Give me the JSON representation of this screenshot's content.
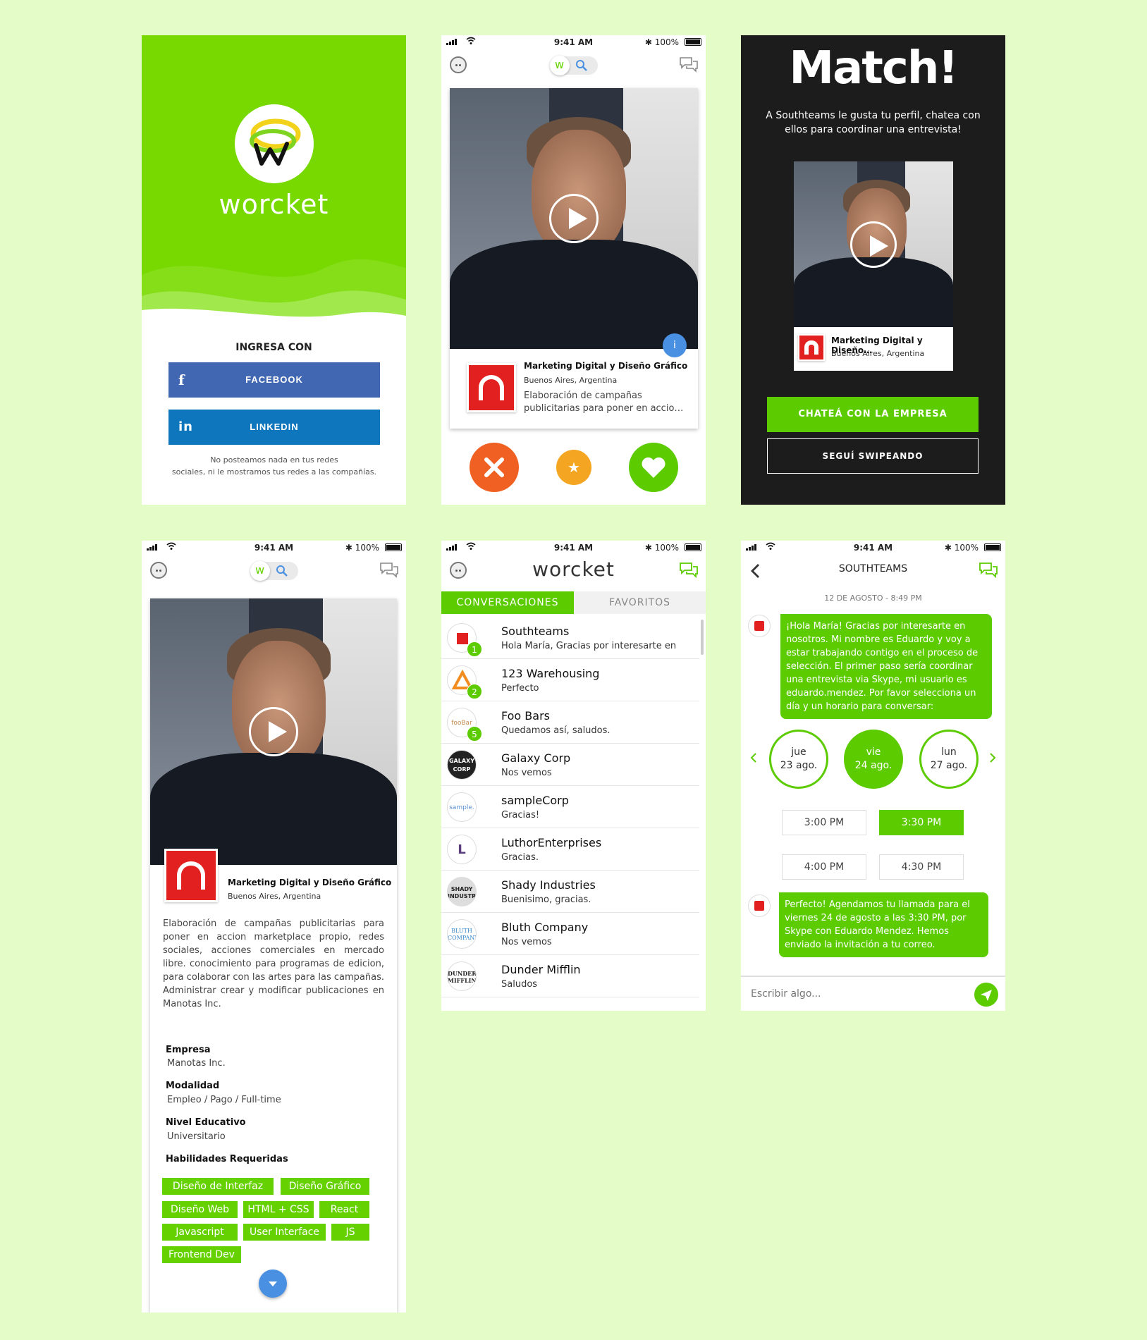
{
  "status": {
    "time": "9:41 AM",
    "battery": "100%"
  },
  "login": {
    "brand": "worcket",
    "ingresa": "INGRESA CON",
    "facebook": "FACEBOOK",
    "linkedin": "LINKEDIN",
    "fine_line1": "No posteamos nada en tus redes",
    "fine_line2": "sociales, ni le mostramos tus redes a las compañías."
  },
  "swipe": {
    "job_title": "Marketing Digital y Diseño Gráfico",
    "location": "Buenos Aires, Argentina",
    "desc_line1": "Elaboración de campañas",
    "desc_line2": "publicitarias para poner en accio…",
    "info": "i"
  },
  "match": {
    "title": "Match!",
    "text": "A Southteams le gusta tu perfil, chatea con ellos para coordinar una entrevista!",
    "card_title": "Marketing Digital y Diseño…",
    "card_location": "Buenos Aires, Argentina",
    "chat_button": "CHATEÁ CON LA EMPRESA",
    "swipe_button": "SEGUÍ SWIPEANDO"
  },
  "detail": {
    "job_title": "Marketing Digital y Diseño Gráfico",
    "location": "Buenos Aires, Argentina",
    "description": "Elaboración de campañas publicitarias para poner en accion marketplace propio, redes sociales, acciones comerciales en mercado libre. conocimiento para programas de edicion, para colaborar con las artes para las campañas. Administrar crear y modificar publicaciones en Manotas Inc.",
    "empresa_label": "Empresa",
    "empresa_value": "Manotas Inc.",
    "modalidad_label": "Modalidad",
    "modalidad_value": "Empleo / Pago / Full-time",
    "nivel_label": "Nivel Educativo",
    "nivel_value": "Universitario",
    "habilidades_label": "Habilidades Requeridas",
    "skills": [
      "Diseño de Interfaz",
      "Diseño Gráfico",
      "Diseño Web",
      "HTML + CSS",
      "React",
      "Javascript",
      "User Interface",
      "JS",
      "Frontend Dev"
    ]
  },
  "conversations": {
    "brand": "worcket",
    "tab_conversaciones": "CONVERSACIONES",
    "tab_favoritos": "FAVORITOS",
    "items": [
      {
        "name": "Southteams",
        "msg": "Hola María, Gracias por interesarte en",
        "badge": "1",
        "avatar": ""
      },
      {
        "name": "123 Warehousing",
        "msg": "Perfecto",
        "badge": "2",
        "avatar": ""
      },
      {
        "name": "Foo Bars",
        "msg": "Quedamos así, saludos.",
        "badge": "5",
        "avatar": "fooBar"
      },
      {
        "name": "Galaxy Corp",
        "msg": "Nos vemos",
        "badge": "",
        "avatar": "GALAXY CORP"
      },
      {
        "name": "sampleCorp",
        "msg": "Gracias!",
        "badge": "",
        "avatar": "sample."
      },
      {
        "name": "LuthorEnterprises",
        "msg": "Gracias.",
        "badge": "",
        "avatar": "L"
      },
      {
        "name": "Shady Industries",
        "msg": "Buenisimo, gracias.",
        "badge": "",
        "avatar": "SHADY INDUSTRIES"
      },
      {
        "name": "Bluth Company",
        "msg": "Nos vemos",
        "badge": "",
        "avatar": "BLUTH COMPANY"
      },
      {
        "name": "Dunder Mifflin",
        "msg": "Saludos",
        "badge": "",
        "avatar": "DUNDER MIFFLIN"
      }
    ]
  },
  "chat": {
    "title": "SOUTHTEAMS",
    "date": "12 DE AGOSTO - 8:49 PM",
    "msg1": "¡Hola María! Gracias por interesarte en nosotros. Mi nombre es Eduardo y voy a estar trabajando contigo en el proceso de selección. El primer paso sería coordinar una entrevista via Skype, mi usuario es eduardo.mendez. Por favor selecciona un día y un horario para conversar:",
    "days": [
      {
        "dow": "jue",
        "date": "23 ago."
      },
      {
        "dow": "vie",
        "date": "24 ago."
      },
      {
        "dow": "lun",
        "date": "27 ago."
      }
    ],
    "slots": [
      "3:00 PM",
      "3:30 PM",
      "4:00 PM",
      "4:30 PM"
    ],
    "msg2": "Perfecto! Agendamos tu llamada para el viernes 24 de agosto a las 3:30 PM, por Skype con Eduardo Mendez. Hemos enviado la invitación a tu correo.",
    "placeholder": "Escribir algo..."
  },
  "colors": {
    "accent": "#5ccb00",
    "facebook": "#4267b2",
    "linkedin": "#0e76bc",
    "reject": "#f06022",
    "star": "#f4a623",
    "background": "#e3fcc8"
  }
}
